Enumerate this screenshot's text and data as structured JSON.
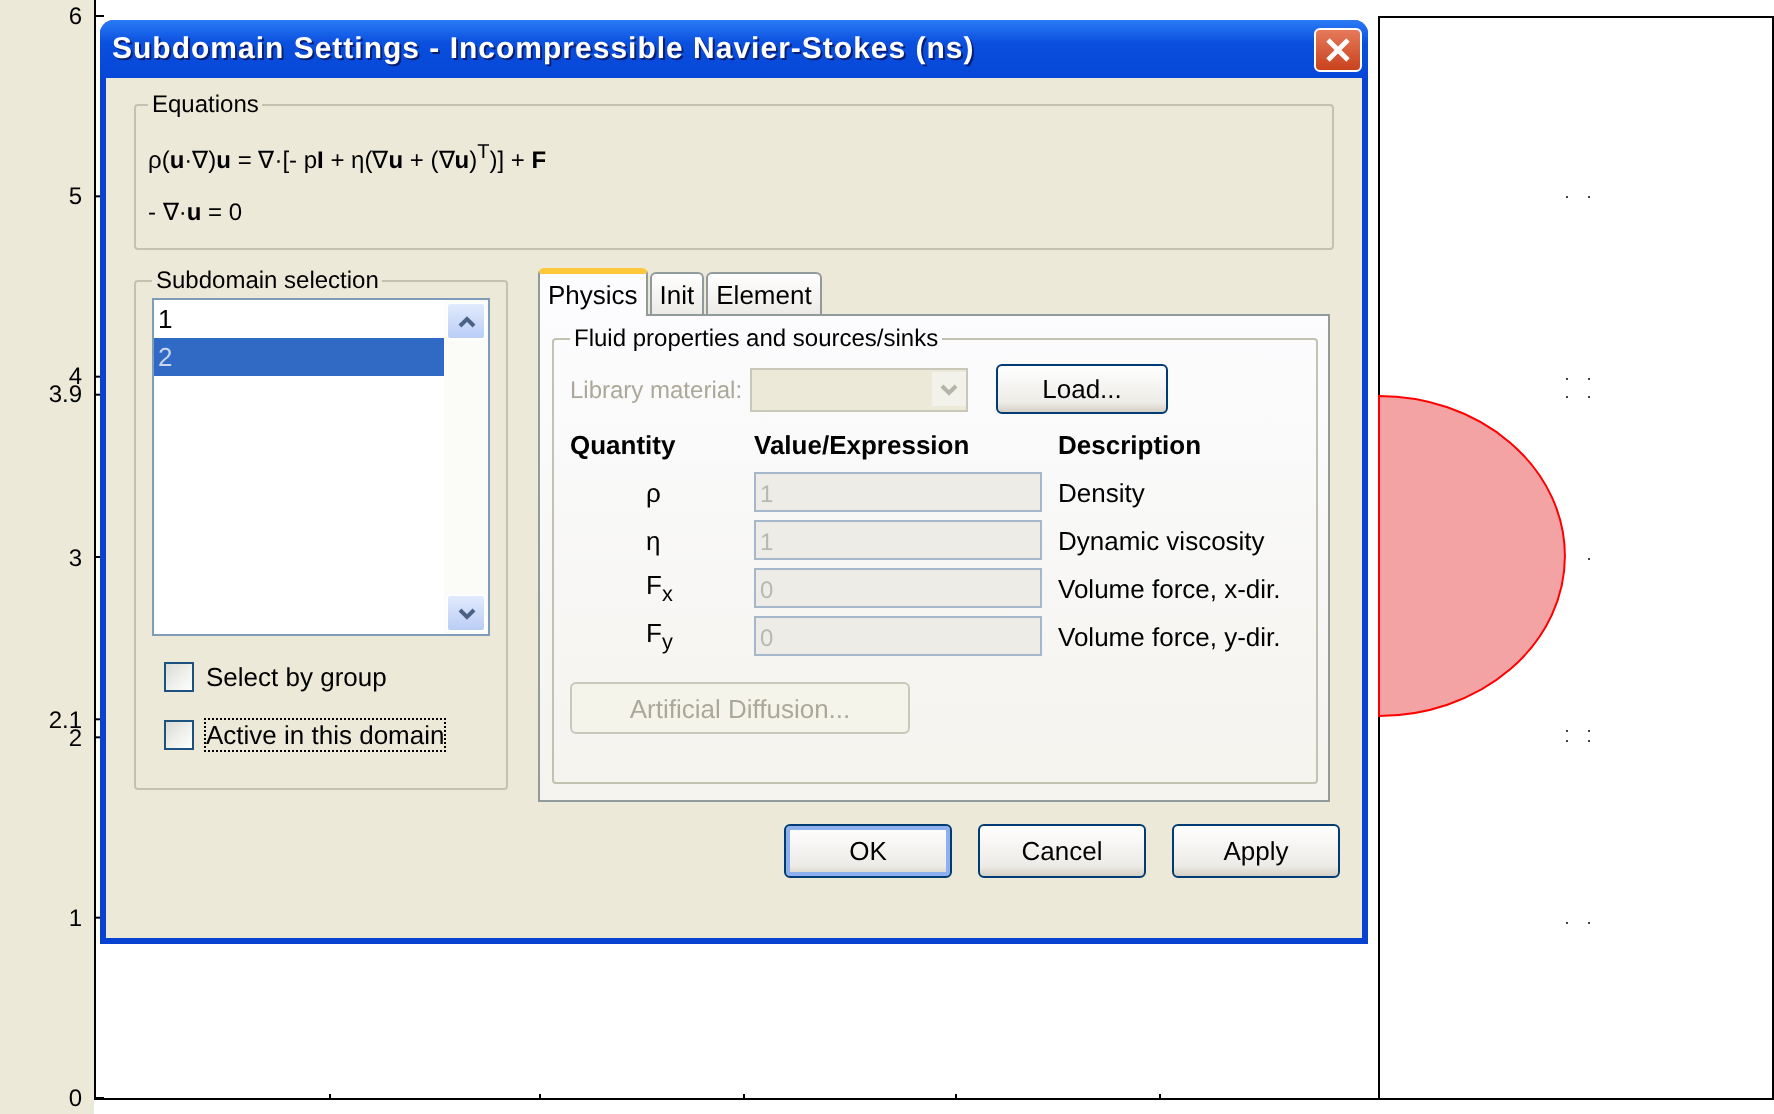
{
  "plot": {
    "y_axis_labels": [
      "6",
      "5",
      "4",
      "3.9",
      "3",
      "2.1",
      "2",
      "1",
      "0"
    ]
  },
  "dialog": {
    "title": "Subdomain Settings - Incompressible Navier-Stokes (ns)",
    "equations": {
      "label": "Equations",
      "lines": [
        "ρ(**u**·∇)**u** = ∇·[- p**I** + η(∇**u** + (∇**u**)$^{T}$)] + **F**",
        "- ∇·**u** = 0"
      ]
    },
    "subdomain_selection": {
      "label": "Subdomain selection",
      "items": [
        {
          "label": "1",
          "selected": false
        },
        {
          "label": "2",
          "selected": true
        }
      ],
      "checkboxes": [
        {
          "label": "Select by group",
          "checked": false,
          "focused": false
        },
        {
          "label": "Active in this domain",
          "checked": false,
          "focused": true
        }
      ]
    },
    "tabs": [
      {
        "label": "Physics",
        "selected": true
      },
      {
        "label": "Init",
        "selected": false
      },
      {
        "label": "Element",
        "selected": false
      }
    ],
    "fluid": {
      "label": "Fluid properties and sources/sinks",
      "library_label": "Library material:",
      "library_disabled": true,
      "load_button": "Load...",
      "columns": [
        "Quantity",
        "Value/Expression",
        "Description"
      ],
      "rows": [
        {
          "quantity": "ρ",
          "value": "1",
          "description": "Density",
          "disabled": true
        },
        {
          "quantity": "η",
          "value": "1",
          "description": "Dynamic viscosity",
          "disabled": true
        },
        {
          "quantity": "F$_{x}$",
          "value": "0",
          "description": "Volume force, x-dir.",
          "disabled": true
        },
        {
          "quantity": "F$_{y}$",
          "value": "0",
          "description": "Volume force, y-dir.",
          "disabled": true
        }
      ],
      "diffusion_button": {
        "label": "Artificial Diffusion...",
        "disabled": true
      }
    },
    "buttons": [
      "OK",
      "Cancel",
      "Apply"
    ]
  }
}
